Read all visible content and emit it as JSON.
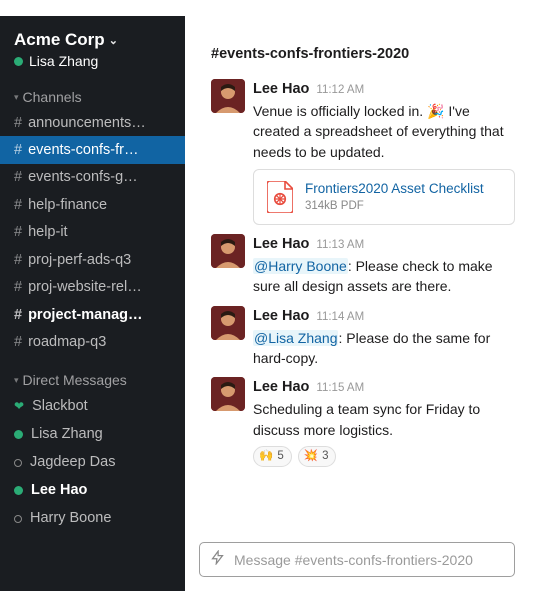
{
  "workspace": {
    "name": "Acme Corp",
    "user": "Lisa Zhang"
  },
  "sidebar": {
    "channels_label": "Channels",
    "dms_label": "Direct Messages",
    "channels": [
      {
        "name": "announcements…",
        "selected": false,
        "unread": false
      },
      {
        "name": "events-confs-fr…",
        "selected": true,
        "unread": false
      },
      {
        "name": "events-confs-g…",
        "selected": false,
        "unread": false
      },
      {
        "name": "help-finance",
        "selected": false,
        "unread": false
      },
      {
        "name": "help-it",
        "selected": false,
        "unread": false
      },
      {
        "name": "proj-perf-ads-q3",
        "selected": false,
        "unread": false
      },
      {
        "name": "proj-website-rel…",
        "selected": false,
        "unread": false
      },
      {
        "name": "project-manag…",
        "selected": false,
        "unread": true
      },
      {
        "name": "roadmap-q3",
        "selected": false,
        "unread": false
      }
    ],
    "dms": [
      {
        "name": "Slackbot",
        "presence": "heart",
        "unread": false
      },
      {
        "name": "Lisa Zhang",
        "presence": "active",
        "unread": false
      },
      {
        "name": "Jagdeep Das",
        "presence": "away",
        "unread": false
      },
      {
        "name": "Lee Hao",
        "presence": "active",
        "unread": true
      },
      {
        "name": "Harry Boone",
        "presence": "away",
        "unread": false
      }
    ]
  },
  "channel": {
    "title": "#events-confs-frontiers-2020",
    "composer_placeholder": "Message #events-confs-frontiers-2020"
  },
  "messages": [
    {
      "sender": "Lee Hao",
      "time": "11:12 AM",
      "text_pre": "Venue is officially locked in. ",
      "emoji": "🎉",
      "text_post": " I've created a spreadsheet of everything that needs to be updated.",
      "attachment": {
        "title": "Frontiers2020 Asset Checklist",
        "meta": "314kB PDF"
      }
    },
    {
      "sender": "Lee Hao",
      "time": "11:13 AM",
      "mention": "@Harry Boone",
      "text_post": ": Please check to make sure all design assets are there."
    },
    {
      "sender": "Lee Hao",
      "time": "11:14 AM",
      "mention": "@Lisa Zhang",
      "text_post": ": Please do the same for hard-copy."
    },
    {
      "sender": "Lee Hao",
      "time": "11:15 AM",
      "text_pre": "Scheduling a team sync for Friday to discuss more logistics.",
      "reactions": [
        {
          "emoji": "🙌",
          "count": "5"
        },
        {
          "emoji": "💥",
          "count": "3"
        }
      ]
    }
  ]
}
